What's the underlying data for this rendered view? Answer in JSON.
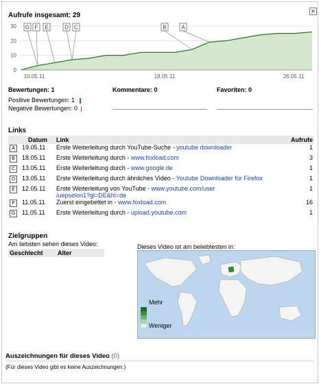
{
  "close_symbol": "×",
  "views": {
    "title": "Aufrufe insgesamt: 29",
    "y_ticks": [
      "30",
      "20",
      "10",
      "0"
    ],
    "x_ticks": [
      "10.05.11",
      "18.05.11",
      "26.05.11"
    ],
    "markers": [
      "G",
      "F",
      "E",
      "D",
      "C",
      "B",
      "A"
    ]
  },
  "chart_data": {
    "type": "area",
    "title": "Aufrufe insgesamt: 29",
    "x_labels": [
      "10.05.11",
      "18.05.11",
      "26.05.11"
    ],
    "x": [
      "10.05.11",
      "11.05.11",
      "12.05.11",
      "13.05.11",
      "14.05.11",
      "15.05.11",
      "16.05.11",
      "17.05.11",
      "18.05.11",
      "19.05.11",
      "20.05.11",
      "21.05.11",
      "22.05.11",
      "23.05.11",
      "24.05.11",
      "25.05.11",
      "26.05.11",
      "27.05.11"
    ],
    "values": [
      0,
      3,
      5,
      7,
      8,
      10,
      10,
      12,
      12,
      12,
      14,
      19,
      20,
      22,
      24,
      25,
      25,
      26
    ],
    "ylim": [
      0,
      30
    ],
    "grid": true,
    "fill_color": "#d6e6cc",
    "line_color": "#2e7d2e"
  },
  "stats": {
    "ratings_label": "Bewertungen: 1",
    "positive_label": "Positive Bewertungen: 1",
    "negative_label": "Negative Bewertungen: 0",
    "comments_label": "Kommentare: 0",
    "favorites_label": "Favoriten: 0"
  },
  "links": {
    "heading": "Links",
    "col_date": "Datum",
    "col_link": "Link",
    "col_views": "Aufrufe",
    "rows": [
      {
        "marker": "A",
        "date": "19.05.11",
        "text": "Erste Weiterleitung durch YouTube-Suche - ",
        "link": "youtube downloader",
        "link2": "",
        "views": "1"
      },
      {
        "marker": "B",
        "date": "18.05.11",
        "text": "Erste Weiterleitung durch - ",
        "link": "www.foxload.com",
        "link2": "",
        "views": "3"
      },
      {
        "marker": "C",
        "date": "13.05.11",
        "text": "Erste Weiterleitung durch - ",
        "link": "www.google.de",
        "link2": "",
        "views": "1"
      },
      {
        "marker": "D",
        "date": "13.05.11",
        "text": "Erste Weiterleitung durch ähnliches Video - ",
        "link": "Youtube Downloader für Firefox",
        "link2": "",
        "views": "1"
      },
      {
        "marker": "E",
        "date": "12.05.11",
        "text": "Erste Weiterleitung von YouTube - ",
        "link": "www.youtube.com/user",
        "link2": "/uepselon1?gl=DE&hl=de",
        "views": "1"
      },
      {
        "marker": "F",
        "date": "11.05.11",
        "text": "Zuerst eingebettet in - ",
        "link": "www.foxload.com",
        "link2": "",
        "views": "16"
      },
      {
        "marker": "G",
        "date": "11.05.11",
        "text": "Erste Weiterleitung durch - ",
        "link": "upload.youtube.com",
        "link2": "",
        "views": "1"
      }
    ]
  },
  "audience": {
    "heading": "Zielgruppen",
    "subheading": "Am liebsten sehen dieses Video:",
    "col_gender": "Geschlecht",
    "col_age": "Alter",
    "map_label": "Dieses Video ist am beliebtesten in:",
    "legend_more": "Mehr",
    "legend_less": "Weniger"
  },
  "awards": {
    "heading": "Auszeichnungen für dieses Video",
    "count": "(0)",
    "empty_text": "(Für dieses Video gibt es keine Auszeichnungen.)"
  }
}
